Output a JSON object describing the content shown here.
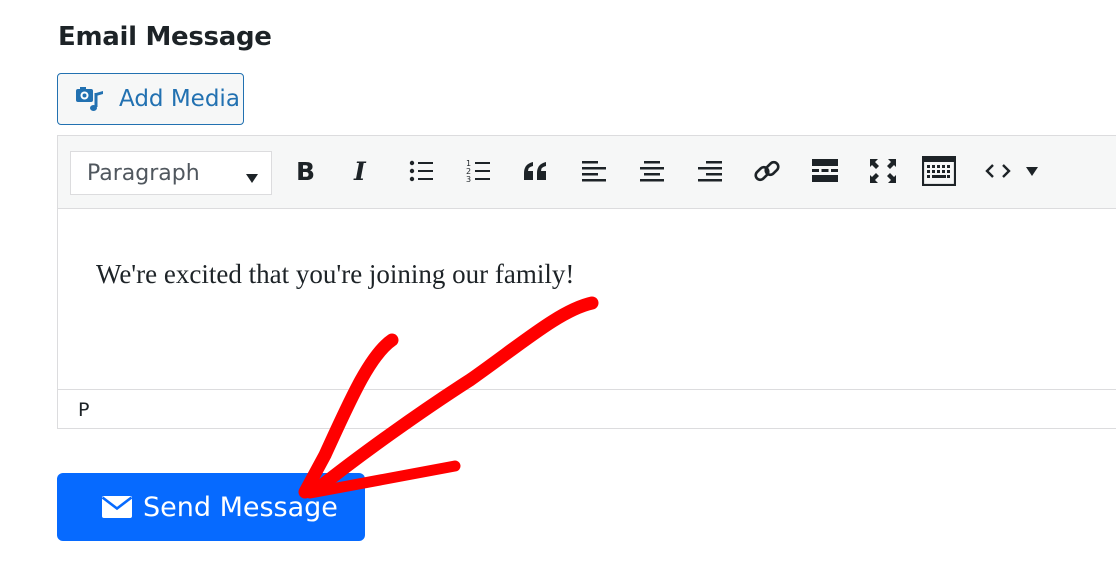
{
  "field": {
    "label": "Email Message"
  },
  "media": {
    "add_label": "Add Media",
    "icon": "add-media-icon"
  },
  "toolbar": {
    "format_value": "Paragraph",
    "buttons": [
      {
        "name": "bold",
        "icon": "bold-icon"
      },
      {
        "name": "italic",
        "icon": "italic-icon"
      },
      {
        "name": "bulleted-list",
        "icon": "bulleted-list-icon"
      },
      {
        "name": "numbered-list",
        "icon": "numbered-list-icon"
      },
      {
        "name": "blockquote",
        "icon": "quote-icon"
      },
      {
        "name": "align-left",
        "icon": "align-left-icon"
      },
      {
        "name": "align-center",
        "icon": "align-center-icon"
      },
      {
        "name": "align-right",
        "icon": "align-right-icon"
      },
      {
        "name": "insert-link",
        "icon": "link-icon"
      },
      {
        "name": "read-more",
        "icon": "read-more-icon"
      },
      {
        "name": "fullscreen",
        "icon": "fullscreen-icon"
      },
      {
        "name": "toolbar-toggle",
        "icon": "keyboard-icon"
      },
      {
        "name": "code",
        "icon": "code-icon"
      },
      {
        "name": "more",
        "icon": "caret-down-icon"
      }
    ]
  },
  "editor": {
    "content": "We're excited that you're joining our family!",
    "path": "P"
  },
  "submit": {
    "label": "Send Message",
    "icon": "envelope-icon"
  },
  "annotation": {
    "type": "red-arrow",
    "color": "#ff0000",
    "points_to": "submit"
  },
  "colors": {
    "link_blue": "#2271b1",
    "button_blue": "#066aff",
    "arrow_red": "#ff0000"
  }
}
